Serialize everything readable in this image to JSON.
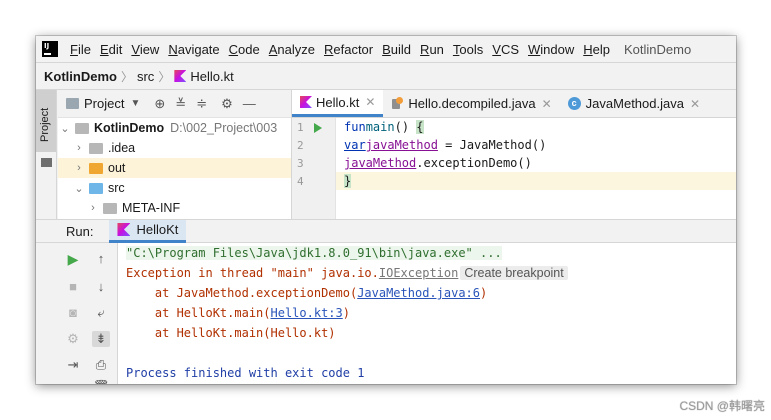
{
  "menu": {
    "logo": "IJ",
    "items": [
      "File",
      "Edit",
      "View",
      "Navigate",
      "Code",
      "Analyze",
      "Refactor",
      "Build",
      "Run",
      "Tools",
      "VCS",
      "Window",
      "Help"
    ],
    "project_title": "KotlinDemo"
  },
  "breadcrumb": {
    "project": "KotlinDemo",
    "folder": "src",
    "file": "Hello.kt"
  },
  "side_strip": {
    "project_label": "Project"
  },
  "project_panel": {
    "title": "Project",
    "root_name": "KotlinDemo",
    "root_path": "D:\\002_Project\\003",
    "items": [
      ".idea",
      "out",
      "src",
      "META-INF"
    ]
  },
  "editor": {
    "tabs": [
      {
        "label": "Hello.kt"
      },
      {
        "label": "Hello.decompiled.java"
      },
      {
        "label": "JavaMethod.java"
      }
    ],
    "line_numbers": [
      "1",
      "2",
      "3",
      "4"
    ],
    "code": {
      "l1_kw": "fun",
      "l1_fn": "main",
      "l1_rest": "() ",
      "l1_brace": "{",
      "l2_kw": "var",
      "l2_var": "javaMethod",
      "l2_rest": " = JavaMethod()",
      "l3_var": "javaMethod",
      "l3_rest": ".exceptionDemo()",
      "l4_brace": "}"
    }
  },
  "run_panel": {
    "label": "Run:",
    "tab": "HelloKt",
    "console": {
      "cmd": "\"C:\\Program Files\\Java\\jdk1.8.0_91\\bin\\java.exe\" ...",
      "exc_prefix": "Exception in thread \"main\" java.io.",
      "exc_link": "IOException",
      "exc_badge": "Create breakpoint",
      "at1_prefix": "    at JavaMethod.exceptionDemo(",
      "at1_link": "JavaMethod.java:6",
      "at1_suffix": ")",
      "at2_prefix": "    at HelloKt.main(",
      "at2_link": "Hello.kt:3",
      "at2_suffix": ")",
      "at3": "    at HelloKt.main(Hello.kt)",
      "finished": "Process finished with exit code 1"
    }
  },
  "watermark": "CSDN @韩曙亮",
  "colors": {
    "accent": "#4083c9",
    "keyword": "#0033b3",
    "error": "#b03000",
    "run_green": "#45a84a"
  }
}
